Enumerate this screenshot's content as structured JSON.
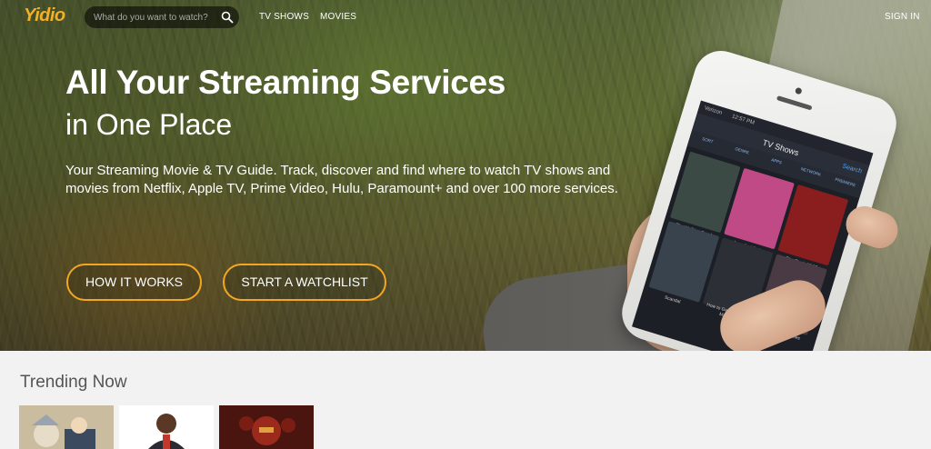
{
  "brand": {
    "logo_text": "Yidio",
    "accent_color": "#f4a623"
  },
  "nav": {
    "search_placeholder": "What do you want to watch?",
    "search_icon": "search-icon",
    "links": [
      {
        "label": "TV SHOWS"
      },
      {
        "label": "MOVIES"
      }
    ],
    "sign_in": "SIGN IN"
  },
  "hero": {
    "headline": "All Your Streaming Services",
    "subline": "in One Place",
    "description": "Your Streaming Movie & TV Guide. Track, discover and find where to watch TV shows and movies from Netflix, Apple TV, Prime Video, Hulu, Paramount+ and over 100 more services.",
    "buttons": [
      {
        "label": "HOW IT WORKS"
      },
      {
        "label": "START A WATCHLIST"
      }
    ]
  },
  "phone_screen": {
    "carrier": "Verizon",
    "time": "12:57 PM",
    "title": "TV Shows",
    "search_label": "Search",
    "tabs": [
      "SORT",
      "GENRE",
      "APPS",
      "NETWORK",
      "PREMIERE"
    ],
    "posters": [
      {
        "title": "The Walking Dead",
        "color": "#3c4a45"
      },
      {
        "title": "Jane the Virgin",
        "color": "#c04a86"
      },
      {
        "title": "The Flash 02.03",
        "color": "#8a1d1d"
      },
      {
        "title": "Scandal",
        "color": "#39434e"
      },
      {
        "title": "How to Get Away with Murder",
        "color": "#2d2f36"
      },
      {
        "title": "The Vampire Diaries",
        "color": "#4a3a44"
      }
    ]
  },
  "trending": {
    "title": "Trending Now",
    "cards": [
      {
        "color": "#c7b99a",
        "name": "trending-card-anime"
      },
      {
        "color": "#ffffff",
        "name": "trending-card-comedian"
      },
      {
        "color": "#5a1a14",
        "name": "trending-card-horror"
      }
    ]
  }
}
